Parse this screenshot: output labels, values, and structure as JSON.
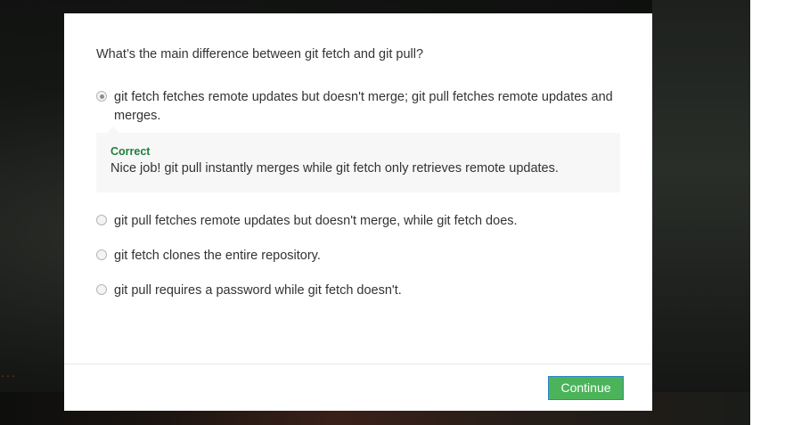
{
  "background": {
    "caption": "..."
  },
  "quiz": {
    "question": "What’s the main difference between git fetch and git pull?",
    "options": [
      {
        "label": "git fetch fetches remote updates but doesn't merge; git pull fetches remote updates and merges.",
        "selected": true
      },
      {
        "label": "git pull fetches remote updates but doesn't merge, while git fetch does.",
        "selected": false
      },
      {
        "label": "git fetch clones the entire repository.",
        "selected": false
      },
      {
        "label": "git pull requires a password while git fetch doesn't.",
        "selected": false
      }
    ],
    "feedback": {
      "title": "Correct",
      "text": "Nice job! git pull instantly merges while git fetch only retrieves remote updates."
    },
    "continue_label": "Continue"
  },
  "colors": {
    "correct": "#1e7f3a",
    "button": "#4bb45a",
    "button_border": "#2f84c7"
  }
}
